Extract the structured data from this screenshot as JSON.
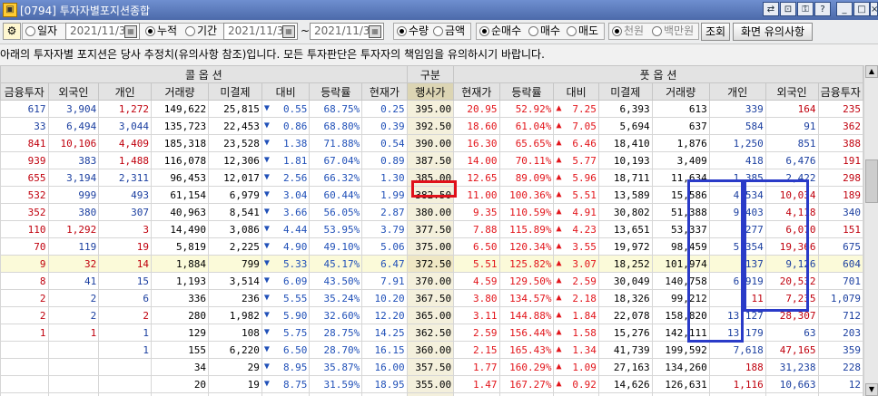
{
  "window": {
    "title": "[0794] 투자자별포지션종합",
    "controls": [
      "link",
      "fit",
      "lock",
      "pin",
      "help",
      "minimize",
      "maximize",
      "close"
    ]
  },
  "toolbar": {
    "mode_daily": "일자",
    "mode_cumulative": "누적",
    "mode_period": "기간",
    "date1": "2021/11/30",
    "date2": "2021/11/30",
    "date3": "2021/11/30",
    "tilde": "~",
    "qty": "수량",
    "amount": "금액",
    "netbuy": "순매수",
    "buy": "매수",
    "sell": "매도",
    "unit_won": "천원",
    "unit_million": "백만원",
    "query_btn": "조회",
    "notice_btn": "화면 유의사항"
  },
  "notice": "아래의 투자자별 포지션은 당사 추정치(유의사항 참조)입니다. 모든 투자판단은 투자자의 책임임을 유의하시기 바랍니다.",
  "headers": {
    "call": "콜 옵 션",
    "gubun": "구분",
    "put": "풋 옵 션",
    "columns": [
      "금융투자",
      "외국인",
      "개인",
      "거래량",
      "미결제",
      "대비",
      "등락률",
      "현재가",
      "행사가",
      "현재가",
      "등락률",
      "대비",
      "미결제",
      "거래량",
      "개인",
      "외국인",
      "금융투자"
    ]
  },
  "rows": [
    {
      "c": [
        "617",
        "3,904",
        "1,272",
        "149,622",
        "25,815",
        "0.55",
        "68.75%",
        "0.25"
      ],
      "k": "395.00",
      "p": [
        "20.95",
        "52.92%",
        "7.25",
        "6,393",
        "613",
        "339",
        "164",
        "235"
      ],
      "cc": [
        "neg",
        "neg",
        "pos"
      ],
      "pc": [
        "neg",
        "pos",
        "pos"
      ]
    },
    {
      "c": [
        "33",
        "6,494",
        "3,044",
        "135,723",
        "22,453",
        "0.86",
        "68.80%",
        "0.39"
      ],
      "k": "392.50",
      "p": [
        "18.60",
        "61.04%",
        "7.05",
        "5,694",
        "637",
        "584",
        "91",
        "362"
      ],
      "cc": [
        "neg",
        "neg",
        "neg"
      ],
      "pc": [
        "neg",
        "neg",
        "pos"
      ]
    },
    {
      "c": [
        "841",
        "10,106",
        "4,409",
        "185,318",
        "23,528",
        "1.38",
        "71.88%",
        "0.54"
      ],
      "k": "390.00",
      "p": [
        "16.30",
        "65.65%",
        "6.46",
        "18,410",
        "1,876",
        "1,250",
        "851",
        "388"
      ],
      "cc": [
        "pos",
        "pos",
        "pos"
      ],
      "pc": [
        "neg",
        "neg",
        "pos"
      ]
    },
    {
      "c": [
        "939",
        "383",
        "1,488",
        "116,078",
        "12,306",
        "1.81",
        "67.04%",
        "0.89"
      ],
      "k": "387.50",
      "p": [
        "14.00",
        "70.11%",
        "5.77",
        "10,193",
        "3,409",
        "418",
        "6,476",
        "191"
      ],
      "cc": [
        "pos",
        "neg",
        "pos"
      ],
      "pc": [
        "neg",
        "neg",
        "pos"
      ]
    },
    {
      "c": [
        "655",
        "3,194",
        "2,311",
        "96,453",
        "12,017",
        "2.56",
        "66.32%",
        "1.30"
      ],
      "k": "385.00",
      "p": [
        "12.65",
        "89.09%",
        "5.96",
        "18,711",
        "11,634",
        "1,385",
        "2,422",
        "298"
      ],
      "cc": [
        "pos",
        "neg",
        "neg"
      ],
      "pc": [
        "neg",
        "neg",
        "pos"
      ]
    },
    {
      "c": [
        "532",
        "999",
        "493",
        "61,154",
        "6,979",
        "3.04",
        "60.44%",
        "1.99"
      ],
      "k": "382.50",
      "p": [
        "11.00",
        "100.36%",
        "5.51",
        "13,589",
        "15,586",
        "4,534",
        "10,034",
        "189"
      ],
      "cc": [
        "pos",
        "neg",
        "neg"
      ],
      "pc": [
        "neg",
        "pos",
        "pos"
      ]
    },
    {
      "c": [
        "352",
        "380",
        "307",
        "40,963",
        "8,541",
        "3.66",
        "56.05%",
        "2.87"
      ],
      "k": "380.00",
      "p": [
        "9.35",
        "110.59%",
        "4.91",
        "30,802",
        "51,388",
        "9,403",
        "4,118",
        "340"
      ],
      "cc": [
        "pos",
        "neg",
        "neg"
      ],
      "pc": [
        "neg",
        "pos",
        "neg"
      ]
    },
    {
      "c": [
        "110",
        "1,292",
        "3",
        "14,490",
        "3,086",
        "4.44",
        "53.95%",
        "3.79"
      ],
      "k": "377.50",
      "p": [
        "7.88",
        "115.89%",
        "4.23",
        "13,651",
        "53,337",
        "277",
        "6,070",
        "151"
      ],
      "cc": [
        "pos",
        "pos",
        "pos"
      ],
      "pc": [
        "neg",
        "pos",
        "pos"
      ]
    },
    {
      "c": [
        "70",
        "119",
        "19",
        "5,819",
        "2,225",
        "4.90",
        "49.10%",
        "5.06"
      ],
      "k": "375.00",
      "p": [
        "6.50",
        "120.34%",
        "3.55",
        "19,972",
        "98,459",
        "5,354",
        "19,366",
        "675"
      ],
      "cc": [
        "pos",
        "neg",
        "pos"
      ],
      "pc": [
        "neg",
        "pos",
        "neg"
      ]
    },
    {
      "c": [
        "9",
        "32",
        "14",
        "1,884",
        "799",
        "5.33",
        "45.17%",
        "6.47"
      ],
      "k": "372.50",
      "p": [
        "5.51",
        "125.82%",
        "3.07",
        "18,252",
        "101,974",
        "137",
        "9,126",
        "604"
      ],
      "cc": [
        "pos",
        "pos",
        "pos"
      ],
      "pc": [
        "neg",
        "neg",
        "neg"
      ],
      "hl": true
    },
    {
      "c": [
        "8",
        "41",
        "15",
        "1,193",
        "3,514",
        "6.09",
        "43.50%",
        "7.91"
      ],
      "k": "370.00",
      "p": [
        "4.59",
        "129.50%",
        "2.59",
        "30,049",
        "140,758",
        "6,919",
        "20,532",
        "701"
      ],
      "cc": [
        "pos",
        "neg",
        "neg"
      ],
      "pc": [
        "neg",
        "pos",
        "neg"
      ]
    },
    {
      "c": [
        "2",
        "2",
        "6",
        "336",
        "236",
        "5.55",
        "35.24%",
        "10.20"
      ],
      "k": "367.50",
      "p": [
        "3.80",
        "134.57%",
        "2.18",
        "18,326",
        "99,212",
        "11",
        "7,235",
        "1,079"
      ],
      "cc": [
        "pos",
        "neg",
        "neg"
      ],
      "pc": [
        "pos",
        "pos",
        "neg"
      ]
    },
    {
      "c": [
        "2",
        "2",
        "2",
        "280",
        "1,982",
        "5.90",
        "32.60%",
        "12.20"
      ],
      "k": "365.00",
      "p": [
        "3.11",
        "144.88%",
        "1.84",
        "22,078",
        "158,820",
        "13,127",
        "28,307",
        "712"
      ],
      "cc": [
        "pos",
        "neg",
        "pos"
      ],
      "pc": [
        "neg",
        "pos",
        "neg"
      ]
    },
    {
      "c": [
        "1",
        "1",
        "1",
        "129",
        "108",
        "5.75",
        "28.75%",
        "14.25"
      ],
      "k": "362.50",
      "p": [
        "2.59",
        "156.44%",
        "1.58",
        "15,276",
        "142,111",
        "13,179",
        "63",
        "203"
      ],
      "cc": [
        "pos",
        "pos",
        "neg"
      ],
      "pc": [
        "neg",
        "neg",
        "neg"
      ]
    },
    {
      "c": [
        "",
        "",
        "1",
        "155",
        "6,220",
        "6.50",
        "28.70%",
        "16.15"
      ],
      "k": "360.00",
      "p": [
        "2.15",
        "165.43%",
        "1.34",
        "41,739",
        "199,592",
        "7,618",
        "47,165",
        "359"
      ],
      "cc": [
        "blk",
        "blk",
        "neg"
      ],
      "pc": [
        "neg",
        "pos",
        "neg"
      ]
    },
    {
      "c": [
        "",
        "",
        "",
        "34",
        "29",
        "8.95",
        "35.87%",
        "16.00"
      ],
      "k": "357.50",
      "p": [
        "1.77",
        "160.29%",
        "1.09",
        "27,163",
        "134,260",
        "188",
        "31,238",
        "228"
      ],
      "cc": [
        "blk",
        "blk",
        "blk"
      ],
      "pc": [
        "pos",
        "neg",
        "neg"
      ]
    },
    {
      "c": [
        "",
        "",
        "",
        "20",
        "19",
        "8.75",
        "31.59%",
        "18.95"
      ],
      "k": "355.00",
      "p": [
        "1.47",
        "167.27%",
        "0.92",
        "14,626",
        "126,631",
        "1,116",
        "10,663",
        "12"
      ],
      "cc": [
        "blk",
        "blk",
        "blk"
      ],
      "pc": [
        "pos",
        "neg",
        "neg"
      ]
    },
    {
      "c": [
        "",
        "",
        "",
        "21",
        "21",
        "7.55",
        "25.46%",
        "22.10"
      ],
      "k": "352.50",
      "p": [
        "1.23",
        "186.05%",
        "0.80",
        "12,715",
        "93,502",
        "957",
        "10,675",
        "29"
      ],
      "cc": [
        "blk",
        "blk",
        "blk"
      ],
      "pc": [
        "pos",
        "pos",
        "neg"
      ]
    }
  ],
  "colors": {
    "up": "#e2141a",
    "down": "#2050b8",
    "highlight_red": "#e0101a",
    "highlight_blue": "#2a3bc8"
  }
}
